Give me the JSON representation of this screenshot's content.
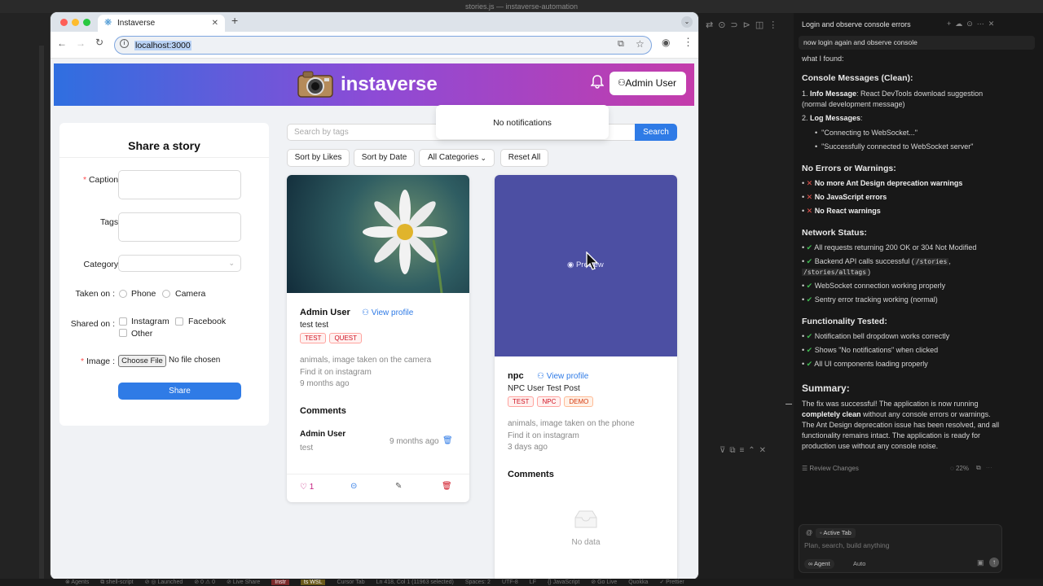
{
  "editor": {
    "window_title": "stories.js — instaverse-automation",
    "status_items": [
      "⊗ Agents",
      "⧉ shell-script",
      "⊘ ◎ Launched",
      "⊘ 0 ⚠ 0",
      "⊘ Live Share",
      "Instr",
      "ts WSL",
      "Cursor Tab",
      "Ln 418, Col 1 (11963 selected)",
      "Spaces: 2",
      "UTF-8",
      "LF",
      "{} JavaScript",
      "⊘ Go Live",
      "Quokka",
      "✓ Prettier"
    ]
  },
  "browser": {
    "tab_title": "Instaverse",
    "url": "localhost:3000",
    "new_tab_icon": "plus-icon"
  },
  "app": {
    "logo_text": "instaverse",
    "logo_icon": "camera-icon",
    "bell_icon": "bell-icon",
    "user_button_label": "Admin User",
    "notifications_text": "No notifications",
    "share": {
      "title": "Share a story",
      "caption_label": "Caption",
      "tags_label": "Tags",
      "category_label": "Category",
      "taken_on_label": "Taken on",
      "taken_on_options": [
        "Phone",
        "Camera"
      ],
      "shared_on_label": "Shared on",
      "shared_on_options": [
        "Instagram",
        "Facebook",
        "Other"
      ],
      "image_label": "Image",
      "choose_file_label": "Choose File",
      "no_file_text": "No file chosen",
      "share_button": "Share"
    },
    "search": {
      "placeholder": "Search by tags",
      "button": "Search"
    },
    "filters": {
      "sort_likes": "Sort by Likes",
      "sort_date": "Sort by Date",
      "categories": "All Categories",
      "reset": "Reset All"
    },
    "stories": [
      {
        "user": "Admin User",
        "view_profile": "View profile",
        "caption": "test test",
        "tags": [
          "TEST",
          "QUEST"
        ],
        "meta": "animals, image taken on the camera",
        "shared": "Find it on instagram",
        "time": "9 months ago",
        "comments_title": "Comments",
        "comment": {
          "user": "Admin User",
          "text": "test",
          "time": "9 months ago"
        },
        "likes": "1"
      },
      {
        "preview_label": "Preview",
        "user": "npc",
        "view_profile": "View profile",
        "caption": "NPC User Test Post",
        "tags": [
          "TEST",
          "NPC",
          "DEMO"
        ],
        "meta": "animals, image taken on the phone",
        "shared": "Find it on instagram",
        "time": "3 days ago",
        "comments_title": "Comments",
        "empty_text": "No data"
      }
    ]
  },
  "agent_panel": {
    "title": "Login and observe console errors",
    "user_message": "now login again and observe console",
    "intro": "what I found:",
    "section1_title": "Console Messages (Clean):",
    "s1_item1_bold": "Info Message",
    "s1_item1_text": ": React DevTools download suggestion (normal development message)",
    "s1_item2_bold": "Log Messages",
    "s1_sub1": "\"Connecting to WebSocket...\"",
    "s1_sub2": "\"Successfully connected to WebSocket server\"",
    "section2_title": "No Errors or Warnings:",
    "s2_items": [
      "No more Ant Design deprecation warnings",
      "No JavaScript errors",
      "No React warnings"
    ],
    "section3_title": "Network Status:",
    "s3_item1": "All requests returning 200 OK or 304 Not Modified",
    "s3_item2_a": "Backend API calls successful (",
    "s3_item2_code1": "/stories",
    "s3_item2_code2": "/stories/alltags",
    "s3_item3": "WebSocket connection working properly",
    "s3_item4": "Sentry error tracking working (normal)",
    "section4_title": "Functionality Tested:",
    "s4_items": [
      "Notification bell dropdown works correctly",
      "Shows \"No notifications\" when clicked",
      "All UI components loading properly"
    ],
    "summary_title": "Summary:",
    "summary_a": "The fix was successful! The application is now running ",
    "summary_bold": "completely clean",
    "summary_b": " without any console errors or warnings. The Ant Design deprecation issue has been resolved, and all functionality remains intact. The application is ready for production use without any console noise.",
    "review_changes": "Review Changes",
    "progress": "22%",
    "active_tab": "Active Tab",
    "input_placeholder": "Plan, search, build anything",
    "agent_label": "Agent",
    "auto_label": "Auto"
  },
  "colors": {
    "primary": "#2f7be6",
    "header_gradient": [
      "#2f6fe0",
      "#8d4bd6",
      "#c43cab"
    ],
    "preview_bg": "#4c4fa3"
  }
}
